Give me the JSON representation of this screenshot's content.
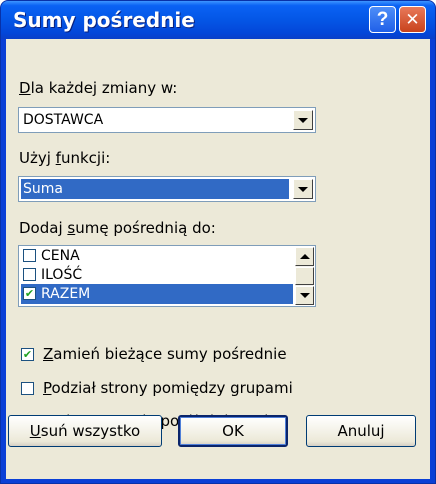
{
  "window": {
    "title": "Sumy pośrednie"
  },
  "titlebar": {
    "help_glyph": "?",
    "close_glyph": "✕"
  },
  "group_by": {
    "label_prefix": "D",
    "label_rest": "la każdej zmiany w:",
    "value": "DOSTAWCA"
  },
  "function": {
    "label_prefix": "Użyj ",
    "label_underline": "f",
    "label_rest": "unkcji:",
    "value": "Suma"
  },
  "add_to": {
    "label_prefix": "Dodaj ",
    "label_underline": "s",
    "label_rest": "umę pośrednią do:",
    "items": [
      {
        "label": "CENA",
        "checked": false
      },
      {
        "label": "ILOŚĆ",
        "checked": false
      },
      {
        "label": "RAZEM",
        "checked": true
      }
    ]
  },
  "options": [
    {
      "underline": "Z",
      "rest": "amień bieżące sumy pośrednie",
      "checked": true
    },
    {
      "underline": "P",
      "rest": "odział strony pomiędzy grupami",
      "checked": false
    },
    {
      "underline": "P",
      "rest": "odsumowanie poniżej danych",
      "checked": true
    }
  ],
  "buttons": {
    "remove_all_underline": "U",
    "remove_all_rest": "suń wszystko",
    "ok": "OK",
    "cancel": "Anuluj"
  },
  "check_glyph": "✔",
  "colors": {
    "titlebar": "#0456e6",
    "dialog_bg": "#ece9d8",
    "selection": "#316ac5",
    "check": "#21a121"
  }
}
